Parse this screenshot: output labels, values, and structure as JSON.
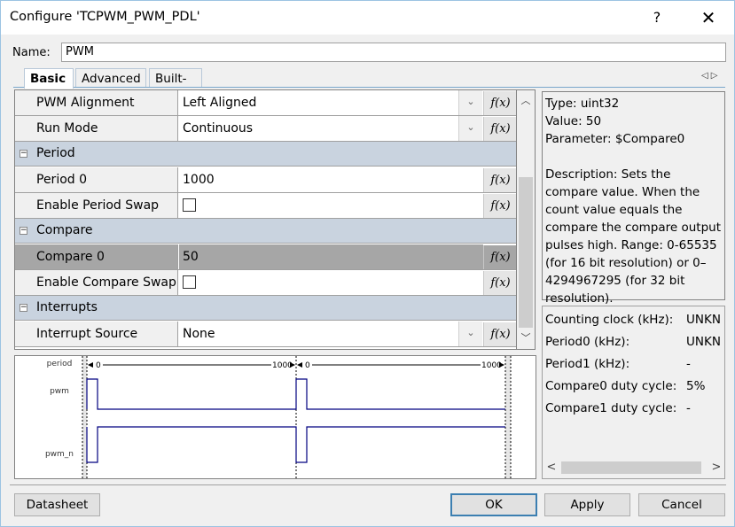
{
  "window": {
    "title": "Configure 'TCPWM_PWM_PDL'",
    "help_icon": "?",
    "close_icon": "✕"
  },
  "name_field": {
    "label": "Name:",
    "value": "PWM"
  },
  "tabs": [
    {
      "label": "Basic",
      "active": true
    },
    {
      "label": "Advanced",
      "active": false
    },
    {
      "label": "Built-in",
      "active": false
    }
  ],
  "tab_nav": {
    "prev": "◁",
    "next": "▷"
  },
  "grid": {
    "rows": [
      {
        "type": "param",
        "label": "PWM Alignment",
        "value": "Left Aligned",
        "dropdown": true
      },
      {
        "type": "param",
        "label": "Run Mode",
        "value": "Continuous",
        "dropdown": true
      },
      {
        "type": "category",
        "label": "Period"
      },
      {
        "type": "param",
        "label": "Period 0",
        "value": "1000",
        "dropdown": false
      },
      {
        "type": "param",
        "label": "Enable Period Swap",
        "checkbox": true,
        "checked": false
      },
      {
        "type": "category",
        "label": "Compare"
      },
      {
        "type": "param",
        "label": "Compare 0",
        "value": "50",
        "dropdown": false,
        "selected": true
      },
      {
        "type": "param",
        "label": "Enable Compare Swap",
        "checkbox": true,
        "checked": false
      },
      {
        "type": "category",
        "label": "Interrupts"
      },
      {
        "type": "param",
        "label": "Interrupt Source",
        "value": "None",
        "dropdown": true
      }
    ],
    "fx_label": "f(x)",
    "collapse_glyph": "−",
    "dropdown_glyph": "⌄"
  },
  "description": {
    "type": "Type: uint32",
    "value": "Value: 50",
    "parameter": "Parameter: $Compare0",
    "text": "Description: Sets the compare value. When the count value equals the compare the compare output pulses high. Range: 0-65535 (for 16 bit resolution) or 0–4294967295 (for 32 bit resolution)."
  },
  "info": [
    {
      "label": "Counting clock (kHz):",
      "value": "UNKN"
    },
    {
      "label": "Period0 (kHz):",
      "value": "UNKN"
    },
    {
      "label": "Period1 (kHz):",
      "value": "-"
    },
    {
      "label": "Compare0 duty cycle:",
      "value": "5%"
    },
    {
      "label": "Compare1 duty cycle:",
      "value": "-"
    }
  ],
  "waveform": {
    "signals": [
      "period",
      "pwm",
      "pwm_n"
    ],
    "period_start_label": "0",
    "period_end_label": "1000",
    "period": 1000,
    "compare": 50,
    "cycles": 2,
    "line_color": "#000080"
  },
  "buttons": {
    "datasheet": "Datasheet",
    "ok": "OK",
    "apply": "Apply",
    "cancel": "Cancel"
  }
}
